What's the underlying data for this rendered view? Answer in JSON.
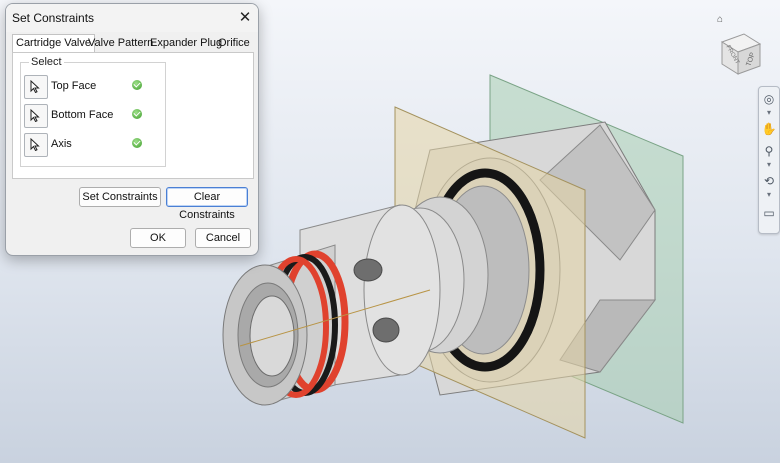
{
  "dialog": {
    "title": "Set Constraints",
    "close_icon": "close-icon",
    "tabs": [
      {
        "label": "Cartridge Valve",
        "active": true
      },
      {
        "label": "Valve Pattern",
        "active": false
      },
      {
        "label": "Expander Plug",
        "active": false
      },
      {
        "label": "Orifice",
        "active": false
      }
    ],
    "select_group": {
      "label": "Select",
      "rows": [
        {
          "label": "Top Face",
          "icon": "cursor-arrow-icon",
          "status": "check-icon"
        },
        {
          "label": "Bottom Face",
          "icon": "cursor-arrow-icon",
          "status": "check-icon"
        },
        {
          "label": "Axis",
          "icon": "cursor-arrow-icon",
          "status": "check-icon"
        }
      ]
    },
    "buttons": {
      "set_constraints": "Set Constraints",
      "clear_constraints": "Clear Constraints",
      "ok": "OK",
      "cancel": "Cancel"
    }
  },
  "viewcube": {
    "faces": [
      "TOP",
      "FRONT"
    ],
    "home_icon": "home-icon"
  },
  "navigation_bar": {
    "icons": [
      "steering-wheel-icon",
      "pan-icon",
      "zoom-icon",
      "orbit-icon",
      "look-at-icon"
    ]
  },
  "colors": {
    "viewport_top": "#f4f6fa",
    "viewport_bottom": "#c9d2df",
    "plane_front": "#d9c99a",
    "plane_back": "#8fbf9c",
    "red_seal": "#e0422e",
    "black_seal": "#1a1a1a",
    "metal": "#c9c9c9",
    "focus_border": "#4a7fd4"
  }
}
